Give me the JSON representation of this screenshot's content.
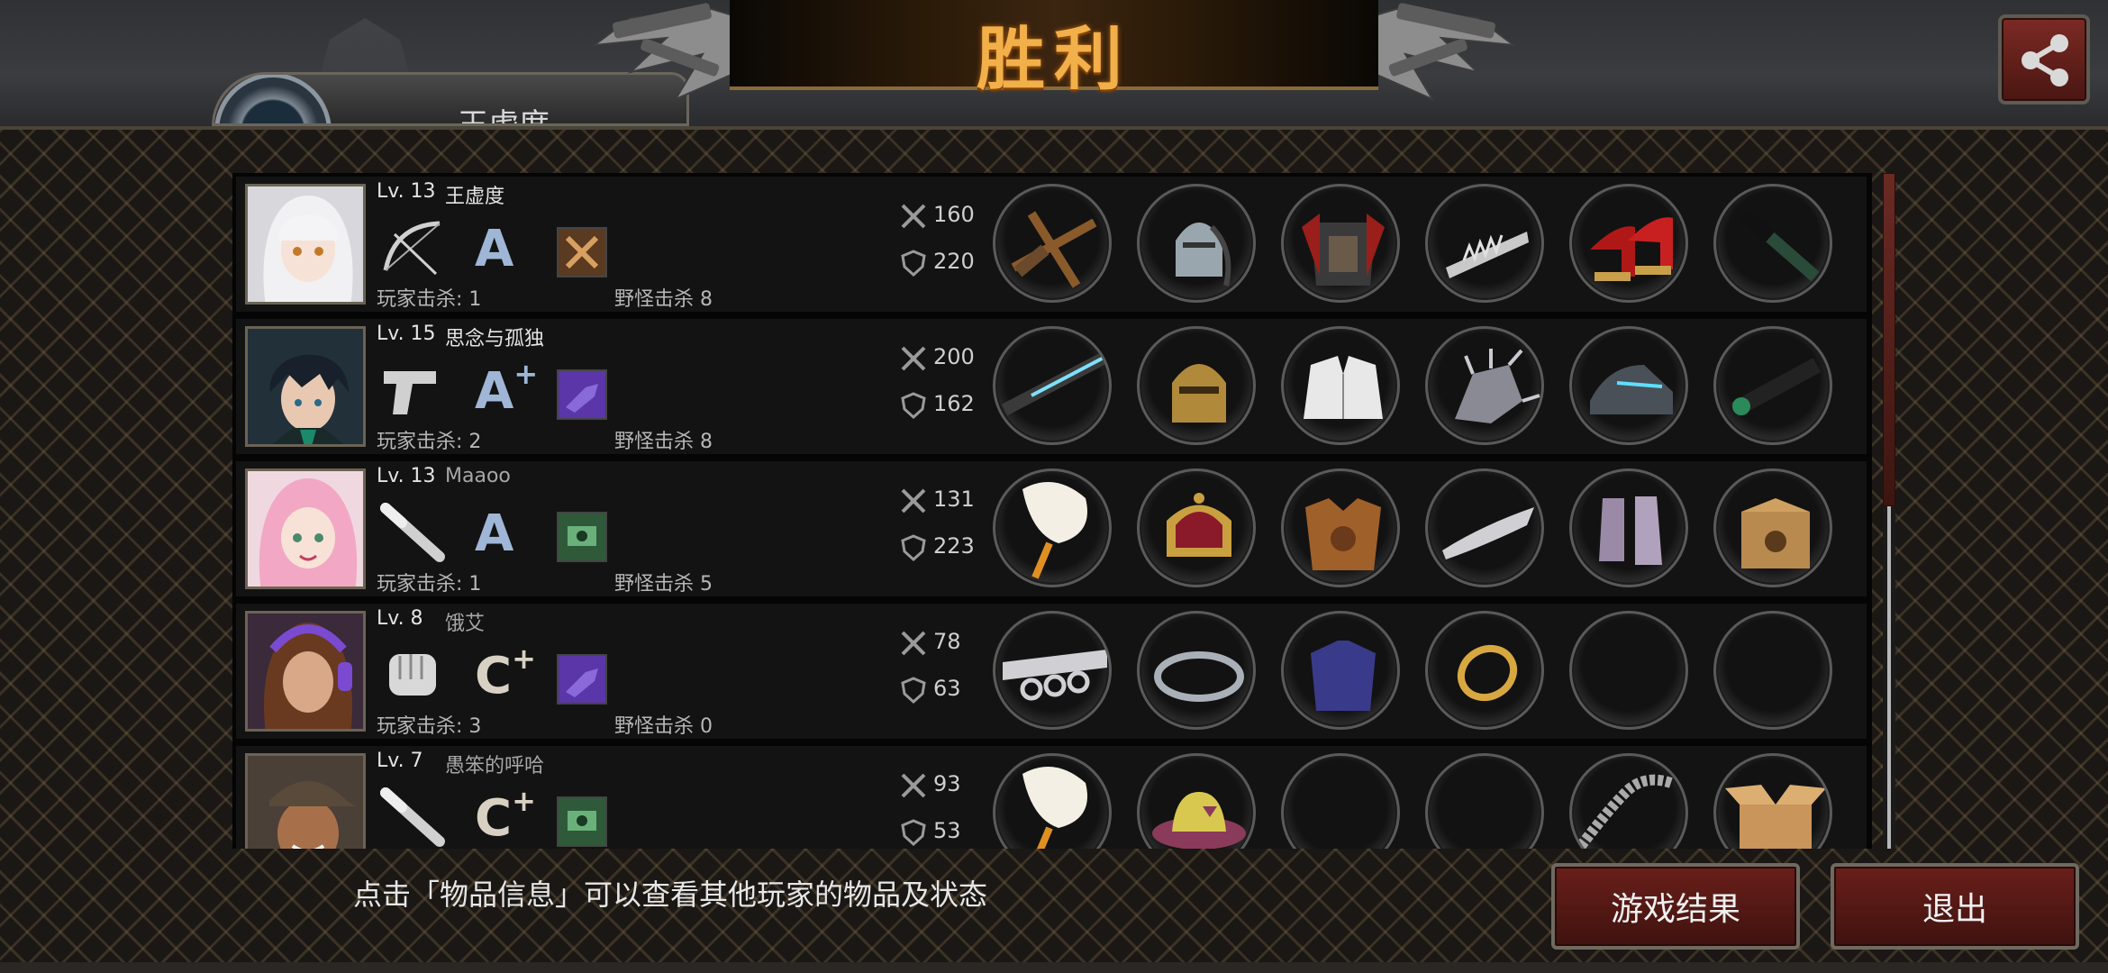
{
  "header": {
    "title": "胜利",
    "player_tab_name": "王虚度",
    "share_icon": "share-icon"
  },
  "rows": [
    {
      "level": "Lv. 13",
      "name": "王虚度",
      "name_dim": false,
      "weapon_icon": "bow-icon",
      "grade": "A",
      "grade_plus": "",
      "skill_color": "#5a3a20",
      "player_kills": "玩家击杀: 1",
      "monster_kills": "野怪击杀 8",
      "attack": "160",
      "defense": "220",
      "items": [
        "crossbow-icon",
        "knight-helmet-icon",
        "red-armor-icon",
        "spiked-bracer-icon",
        "red-heels-icon",
        "green-baton-icon"
      ]
    },
    {
      "level": "Lv. 15",
      "name": "思念与孤独",
      "name_dim": false,
      "weapon_icon": "pistol-icon",
      "grade": "A",
      "grade_plus": "+",
      "skill_color": "#5b36a8",
      "player_kills": "玩家击杀: 2",
      "monster_kills": "野怪击杀 8",
      "attack": "200",
      "defense": "162",
      "items": [
        "laser-rifle-icon",
        "gold-helmet-icon",
        "white-jacket-icon",
        "spiked-gauntlet-icon",
        "tech-boots-icon",
        "scope-icon"
      ]
    },
    {
      "level": "Lv. 13",
      "name": "Maaoo",
      "name_dim": true,
      "weapon_icon": "bat-icon",
      "grade": "A",
      "grade_plus": "",
      "skill_color": "#2f5a3a",
      "player_kills": "玩家击杀: 1",
      "monster_kills": "野怪击杀 5",
      "attack": "131",
      "defense": "223",
      "items": [
        "fan-icon",
        "crown-icon",
        "bronze-armor-icon",
        "blade-bracer-icon",
        "purple-boots-icon",
        "mystery-box-icon"
      ]
    },
    {
      "level": "Lv. 8",
      "name": "饿艾",
      "name_dim": true,
      "weapon_icon": "fist-icon",
      "grade": "C",
      "grade_plus": "+",
      "skill_color": "#5b36a8",
      "player_kills": "玩家击杀: 3",
      "monster_kills": "野怪击杀 0",
      "attack": "78",
      "defense": "63",
      "items": [
        "knuckles-icon",
        "headband-icon",
        "blue-jacket-icon",
        "gold-bracelet-icon",
        "empty-slot",
        "empty-slot"
      ]
    },
    {
      "level": "Lv. 7",
      "name": "愚笨的呼哈",
      "name_dim": true,
      "weapon_icon": "bat-icon",
      "grade": "C",
      "grade_plus": "+",
      "skill_color": "#2f5a3a",
      "player_kills": "",
      "monster_kills": "",
      "attack": "93",
      "defense": "53",
      "items": [
        "fan-icon",
        "sun-hat-icon",
        "empty-slot",
        "empty-slot",
        "chain-whip-icon",
        "cardboard-box-icon"
      ]
    }
  ],
  "footer": {
    "hint": "点击「物品信息」可以查看其他玩家的物品及状态",
    "result_button": "游戏结果",
    "exit_button": "退出"
  },
  "colors": {
    "title_gold": "#f2b04a",
    "button_red": "#6a1f1a",
    "grade_a": "#9fb6d6",
    "grade_c": "#d8d1c3"
  }
}
